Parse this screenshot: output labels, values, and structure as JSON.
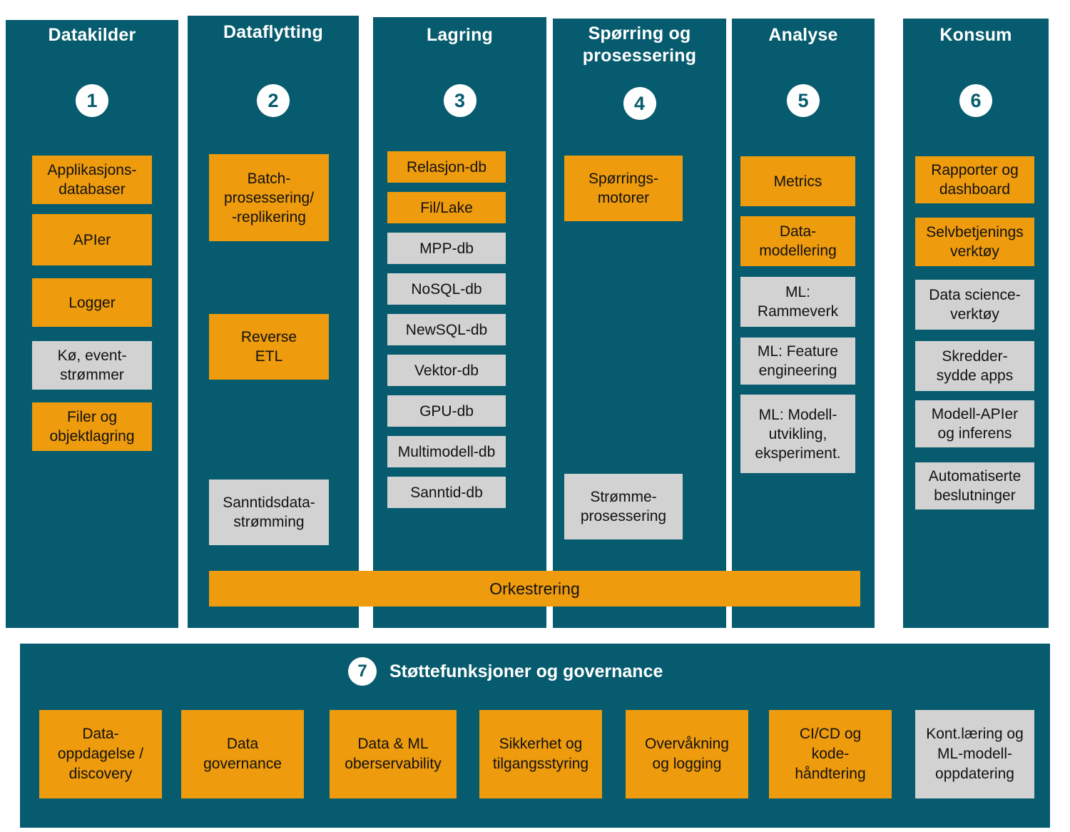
{
  "theme": {
    "teal": "#065B6E",
    "orange": "#EE9B0D",
    "gray": "#D2D2D2",
    "white": "#FFFFFF",
    "text": "#111111"
  },
  "columns": [
    {
      "number": "1",
      "title": "Datakilder",
      "items": [
        {
          "label": "Applikasjons-\ndatabaser",
          "color": "orange"
        },
        {
          "label": "APIer",
          "color": "orange"
        },
        {
          "label": "Logger",
          "color": "orange"
        },
        {
          "label": "Kø, event-\nstrømmer",
          "color": "gray"
        },
        {
          "label": "Filer og\nobjektlagring",
          "color": "orange"
        }
      ]
    },
    {
      "number": "2",
      "title": "Dataflytting",
      "items": [
        {
          "label": "Batch-\nprosessering/\n-replikering",
          "color": "orange"
        },
        {
          "label": "Reverse\nETL",
          "color": "orange"
        },
        {
          "label": "Sanntidsdata-\nstrømming",
          "color": "gray"
        }
      ]
    },
    {
      "number": "3",
      "title": "Lagring",
      "items": [
        {
          "label": "Relasjon-db",
          "color": "orange"
        },
        {
          "label": "Fil/Lake",
          "color": "orange"
        },
        {
          "label": "MPP-db",
          "color": "gray"
        },
        {
          "label": "NoSQL-db",
          "color": "gray"
        },
        {
          "label": "NewSQL-db",
          "color": "gray"
        },
        {
          "label": "Vektor-db",
          "color": "gray"
        },
        {
          "label": "GPU-db",
          "color": "gray"
        },
        {
          "label": "Multimodell-db",
          "color": "gray"
        },
        {
          "label": "Sanntid-db",
          "color": "gray"
        }
      ]
    },
    {
      "number": "4",
      "title": "Spørring og\nprosessering",
      "items": [
        {
          "label": "Spørrings-\nmotorer",
          "color": "orange"
        },
        {
          "label": "Strømme-\nprosessering",
          "color": "gray"
        }
      ]
    },
    {
      "number": "5",
      "title": "Analyse",
      "items": [
        {
          "label": "Metrics",
          "color": "orange"
        },
        {
          "label": "Data-\nmodellering",
          "color": "orange"
        },
        {
          "label": "ML:\nRammeverk",
          "color": "gray"
        },
        {
          "label": "ML: Feature\nengineering",
          "color": "gray"
        },
        {
          "label": "ML: Modell-\nutvikling,\neksperiment.",
          "color": "gray"
        }
      ]
    },
    {
      "number": "6",
      "title": "Konsum",
      "items": [
        {
          "label": "Rapporter og\ndashboard",
          "color": "orange"
        },
        {
          "label": "Selvbetjenings\nverktøy",
          "color": "orange"
        },
        {
          "label": "Data science-\nverktøy",
          "color": "gray"
        },
        {
          "label": "Skredder-\nsydde apps",
          "color": "gray"
        },
        {
          "label": "Modell-APIer\nog inferens",
          "color": "gray"
        },
        {
          "label": "Automatiserte\nbeslutninger",
          "color": "gray"
        }
      ]
    }
  ],
  "orchestration": {
    "label": "Orkestrering"
  },
  "support": {
    "number": "7",
    "title": "Støttefunksjoner og governance",
    "items": [
      {
        "label": "Data-\noppdagelse /\ndiscovery",
        "color": "orange"
      },
      {
        "label": "Data\ngovernance",
        "color": "orange"
      },
      {
        "label": "Data & ML\noberservability",
        "color": "orange"
      },
      {
        "label": "Sikkerhet og\ntilgangsstyring",
        "color": "orange"
      },
      {
        "label": "Overvåkning\nog logging",
        "color": "orange"
      },
      {
        "label": "CI/CD og\nkode-\nhåndtering",
        "color": "orange"
      },
      {
        "label": "Kont.læring og\nML-modell-\noppdatering",
        "color": "gray"
      }
    ]
  }
}
